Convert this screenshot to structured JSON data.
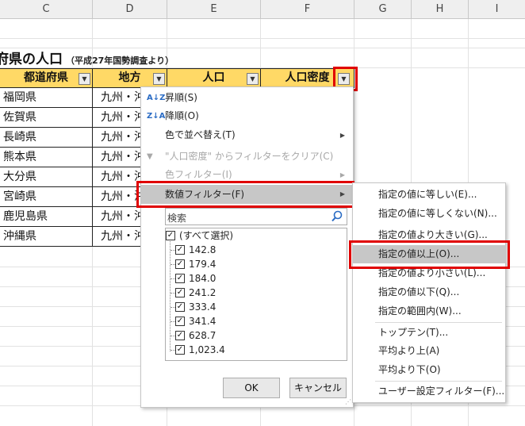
{
  "columns": [
    "C",
    "D",
    "E",
    "F",
    "G",
    "H",
    "I"
  ],
  "title": {
    "main": "府県の人口",
    "sub": "（平成27年国勢調査より）"
  },
  "table": {
    "headers": [
      "都道府県",
      "地方",
      "人口",
      "人口密度"
    ],
    "rows": [
      {
        "pref": "福岡県",
        "region": "九州・沖縄"
      },
      {
        "pref": "佐賀県",
        "region": "九州・沖縄"
      },
      {
        "pref": "長崎県",
        "region": "九州・沖縄"
      },
      {
        "pref": "熊本県",
        "region": "九州・沖縄"
      },
      {
        "pref": "大分県",
        "region": "九州・沖縄"
      },
      {
        "pref": "宮崎県",
        "region": "九州・沖縄"
      },
      {
        "pref": "鹿児島県",
        "region": "九州・沖縄"
      },
      {
        "pref": "沖縄県",
        "region": "九州・沖縄"
      }
    ]
  },
  "menu": {
    "sort_asc": "昇順(S)",
    "sort_desc": "降順(O)",
    "sort_color": "色で並べ替え(T)",
    "clear_filter": "\"人口密度\" からフィルターをクリア(C)",
    "color_filter": "色フィルター(I)",
    "number_filter": "数値フィルター(F)",
    "search_placeholder": "検索",
    "select_all": "(すべて選択)",
    "values": [
      "142.8",
      "179.4",
      "184.0",
      "241.2",
      "333.4",
      "341.4",
      "628.7",
      "1,023.4"
    ],
    "ok": "OK",
    "cancel": "キャンセル"
  },
  "submenu": {
    "items": [
      "指定の値に等しい(E)...",
      "指定の値に等しくない(N)...",
      "指定の値より大きい(G)...",
      "指定の値以上(O)...",
      "指定の値より小さい(L)...",
      "指定の値以下(Q)...",
      "指定の範囲内(W)...",
      "トップテン(T)...",
      "平均より上(A)",
      "平均より下(O)",
      "ユーザー設定フィルター(F)..."
    ]
  },
  "icons": {
    "sort_asc": "A↓Z",
    "sort_desc": "Z↓A",
    "filter_dropdown": "▼",
    "filter_active": "▼",
    "check": "✓",
    "submenu_arrow": "▶",
    "grip": "⋰"
  },
  "colors": {
    "header_fill": "#ffd966",
    "highlight_red": "#e00000",
    "menu_highlight": "#c7c7c7"
  }
}
